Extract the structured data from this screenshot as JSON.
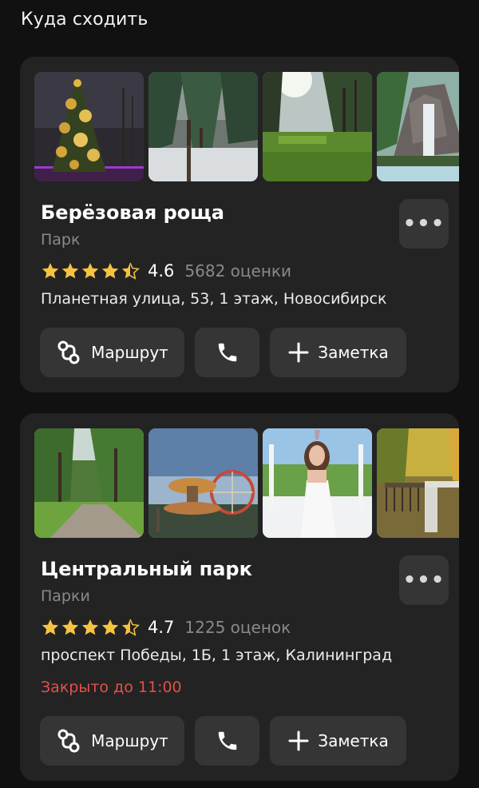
{
  "header": {
    "title": "Куда сходить"
  },
  "colors": {
    "background": "#111111",
    "card": "#232323",
    "button": "#353535",
    "star": "#f5c242",
    "muted_text": "#8a8a8a",
    "closed_status": "#e0524a"
  },
  "places": [
    {
      "name": "Берёзовая роща",
      "category": "Парк",
      "rating": "4.6",
      "rating_stars": 4.6,
      "reviews": "5682 оценки",
      "address": "Планетная улица, 53, 1 этаж, Новосибирск",
      "status": "",
      "photos": [
        "christmas-tree-photo",
        "snowy-pine-forest-photo",
        "sunny-park-lawn-photo",
        "stone-waterfall-photo"
      ],
      "actions": {
        "route": "Маршрут",
        "note": "Заметка"
      },
      "more_label": "•••"
    },
    {
      "name": "Центральный парк",
      "category": "Парки",
      "rating": "4.7",
      "rating_stars": 4.7,
      "reviews": "1225 оценок",
      "address": "проспект Победы, 1Б, 1 этаж, Калининград",
      "status": "Закрыто до 11:00",
      "photos": [
        "park-path-photo",
        "amusement-rides-photo",
        "woman-in-gazebo-photo",
        "autumn-bridge-photo"
      ],
      "actions": {
        "route": "Маршрут",
        "note": "Заметка"
      },
      "more_label": "•••"
    }
  ]
}
